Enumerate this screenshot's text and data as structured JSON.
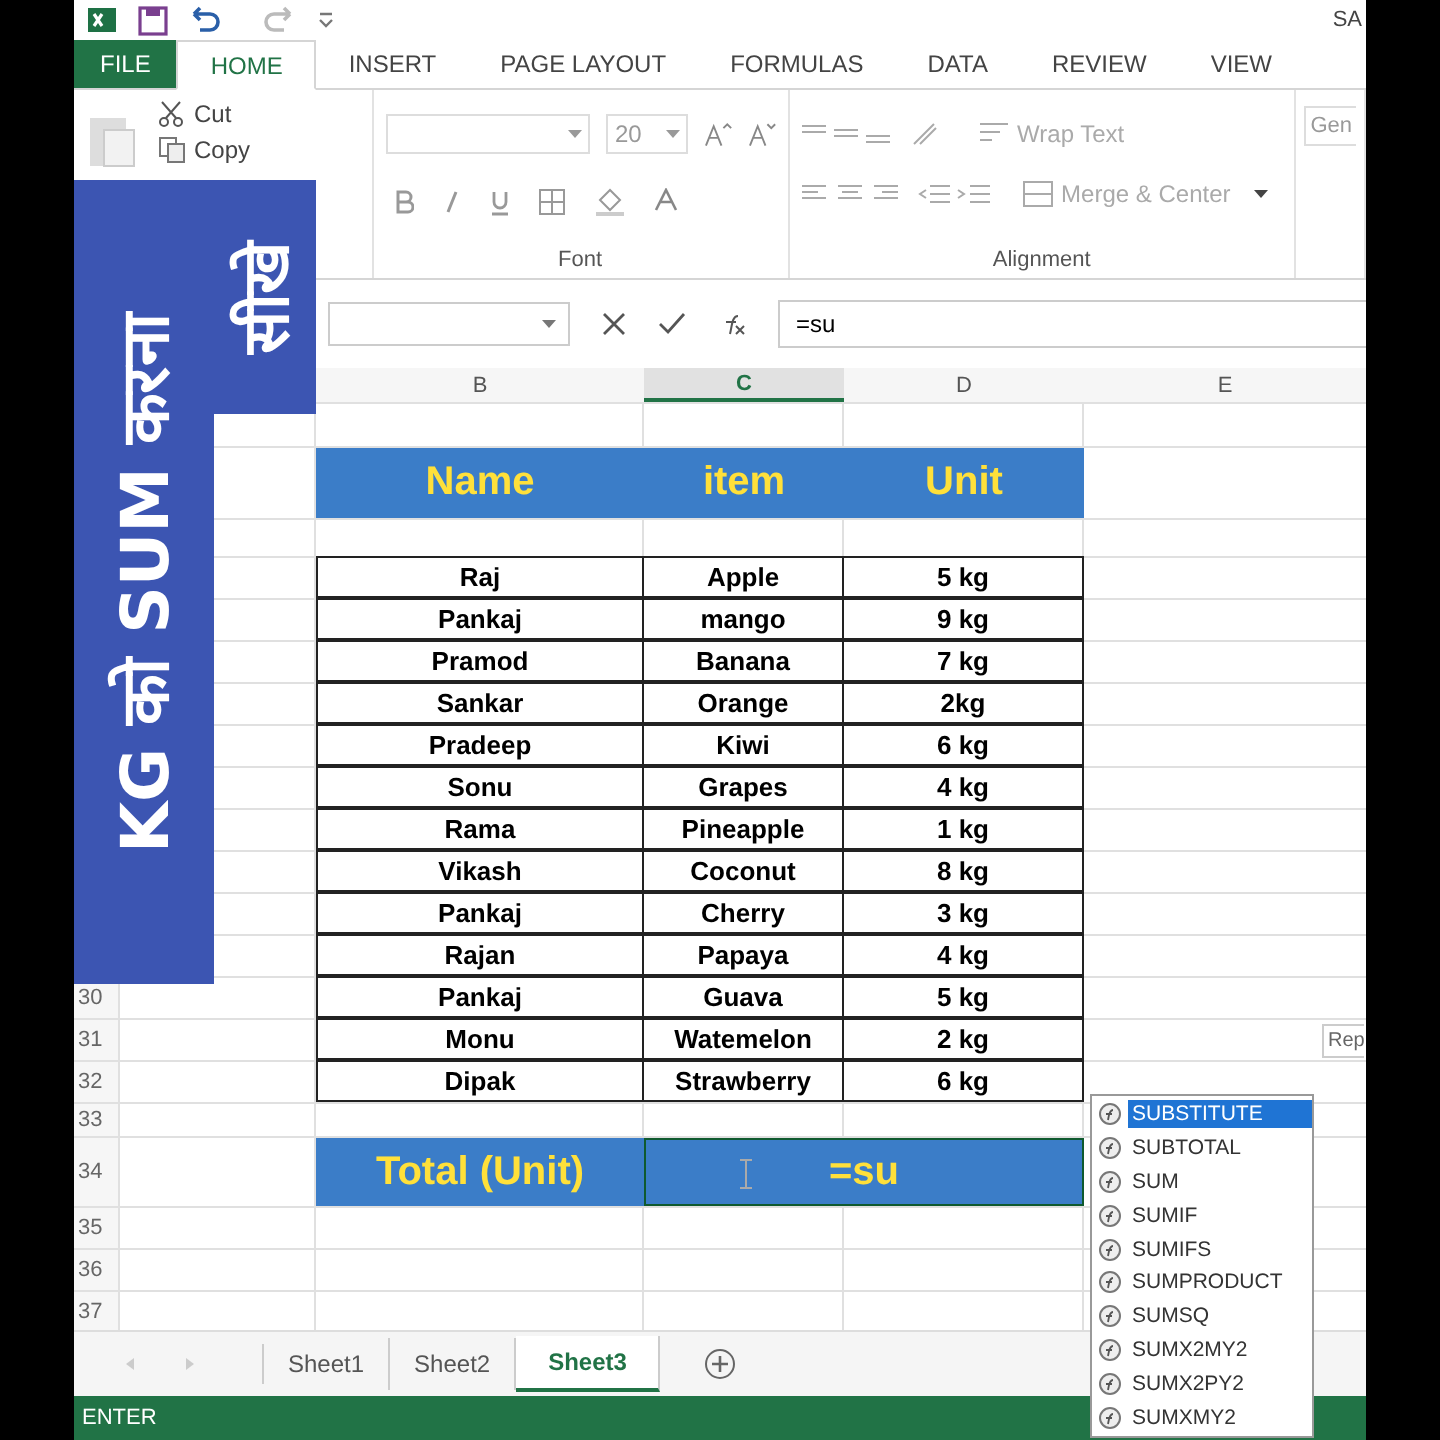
{
  "title_fragment": "SA",
  "tabs": [
    {
      "label": "FILE",
      "kind": "file",
      "selected": false
    },
    {
      "label": "HOME",
      "kind": "tab",
      "selected": true
    },
    {
      "label": "INSERT",
      "kind": "tab",
      "selected": false
    },
    {
      "label": "PAGE LAYOUT",
      "kind": "tab",
      "selected": false
    },
    {
      "label": "FORMULAS",
      "kind": "tab",
      "selected": false
    },
    {
      "label": "DATA",
      "kind": "tab",
      "selected": false
    },
    {
      "label": "REVIEW",
      "kind": "tab",
      "selected": false
    },
    {
      "label": "VIEW",
      "kind": "tab",
      "selected": false
    }
  ],
  "ribbon": {
    "cut": "Cut",
    "copy": "Copy",
    "font_size": "20",
    "font_label": "Font",
    "wrap_text": "Wrap Text",
    "merge_center": "Merge & Center",
    "alignment_label": "Alignment",
    "number_fragment": "Gen"
  },
  "formula_bar": {
    "formula": "=su"
  },
  "columns": [
    {
      "label": "B",
      "selected": false
    },
    {
      "label": "C",
      "selected": true
    },
    {
      "label": "D",
      "selected": false
    },
    {
      "label": "E",
      "selected": false
    }
  ],
  "table": {
    "headers": [
      "Name",
      "item",
      "Unit"
    ],
    "rows": [
      [
        "Raj",
        "Apple",
        "5 kg"
      ],
      [
        "Pankaj",
        "mango",
        "9 kg"
      ],
      [
        "Pramod",
        "Banana",
        "7 kg"
      ],
      [
        "Sankar",
        "Orange",
        "2kg"
      ],
      [
        "Pradeep",
        "Kiwi",
        "6 kg"
      ],
      [
        "Sonu",
        "Grapes",
        "4 kg"
      ],
      [
        "Rama",
        "Pineapple",
        "1 kg"
      ],
      [
        "Vikash",
        "Coconut",
        "8 kg"
      ],
      [
        "Pankaj",
        "Cherry",
        "3 kg"
      ],
      [
        "Rajan",
        "Papaya",
        "4 kg"
      ],
      [
        "Pankaj",
        "Guava",
        "5 kg"
      ],
      [
        "Monu",
        "Watemelon",
        "2 kg"
      ],
      [
        "Dipak",
        "Strawberry",
        "6 kg"
      ]
    ],
    "total_label": "Total (Unit)",
    "total_formula": "=su"
  },
  "row_numbers": [
    "30",
    "31",
    "32",
    "33",
    "34",
    "35",
    "36",
    "37"
  ],
  "tooltip_fragment": "Rep",
  "autocomplete": [
    {
      "label": "SUBSTITUTE",
      "selected": true
    },
    {
      "label": "SUBTOTAL",
      "selected": false
    },
    {
      "label": "SUM",
      "selected": false
    },
    {
      "label": "SUMIF",
      "selected": false
    },
    {
      "label": "SUMIFS",
      "selected": false
    },
    {
      "label": "SUMPRODUCT",
      "selected": false
    },
    {
      "label": "SUMSQ",
      "selected": false
    },
    {
      "label": "SUMX2MY2",
      "selected": false
    },
    {
      "label": "SUMX2PY2",
      "selected": false
    },
    {
      "label": "SUMXMY2",
      "selected": false
    }
  ],
  "sheets": [
    {
      "label": "Sheet1",
      "selected": false
    },
    {
      "label": "Sheet2",
      "selected": false
    },
    {
      "label": "Sheet3",
      "selected": true
    }
  ],
  "status": "ENTER",
  "banner": {
    "main": "KG को SUM करना",
    "side": "सीखे"
  }
}
